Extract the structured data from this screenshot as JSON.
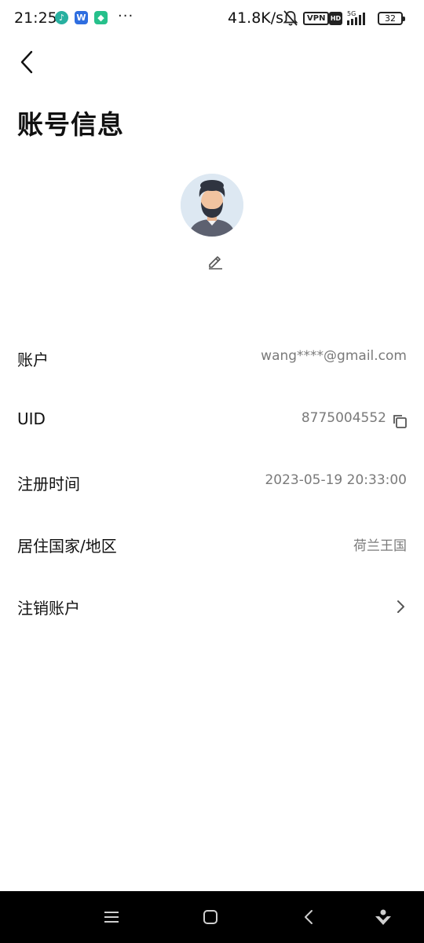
{
  "status_bar": {
    "time": "21:25",
    "app_icons": [
      "tiktok-app-icon",
      "wps-app-icon",
      "shield-app-icon"
    ],
    "overflow": "···",
    "net_speed": "41.8K/s",
    "vpn": "VPN",
    "hd": "HD",
    "network": "5G",
    "battery": "32"
  },
  "header": {
    "title": "账号信息"
  },
  "profile": {
    "avatar": "avatar-image",
    "edit_icon": "pencil-icon"
  },
  "rows": [
    {
      "label": "账户",
      "value": "wang****@gmail.com"
    },
    {
      "label": "UID",
      "value": "8775004552",
      "icon": "copy-icon"
    },
    {
      "label": "注册时间",
      "value": "2023-05-19 20:33:00"
    },
    {
      "label": "居住国家/地区",
      "value": "荷兰王国"
    },
    {
      "label": "注销账户",
      "icon": "chevron-right-icon"
    }
  ],
  "nav": [
    "menu-icon",
    "home-icon",
    "back-icon",
    "assistant-icon"
  ],
  "colors": {
    "background": "#ffffff",
    "text_primary": "#111111",
    "text_secondary": "#7a7a7a",
    "nav_bar": "#000000"
  }
}
